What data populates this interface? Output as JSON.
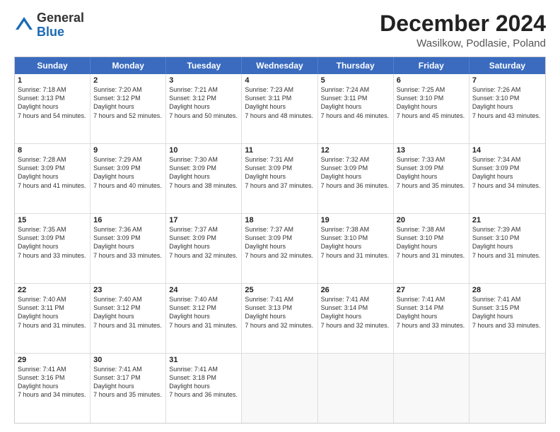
{
  "header": {
    "logo_general": "General",
    "logo_blue": "Blue",
    "main_title": "December 2024",
    "subtitle": "Wasilkow, Podlasie, Poland"
  },
  "days": [
    "Sunday",
    "Monday",
    "Tuesday",
    "Wednesday",
    "Thursday",
    "Friday",
    "Saturday"
  ],
  "weeks": [
    [
      {
        "day": "1",
        "sunrise": "7:18 AM",
        "sunset": "3:13 PM",
        "daylight": "7 hours and 54 minutes."
      },
      {
        "day": "2",
        "sunrise": "7:20 AM",
        "sunset": "3:12 PM",
        "daylight": "7 hours and 52 minutes."
      },
      {
        "day": "3",
        "sunrise": "7:21 AM",
        "sunset": "3:12 PM",
        "daylight": "7 hours and 50 minutes."
      },
      {
        "day": "4",
        "sunrise": "7:23 AM",
        "sunset": "3:11 PM",
        "daylight": "7 hours and 48 minutes."
      },
      {
        "day": "5",
        "sunrise": "7:24 AM",
        "sunset": "3:11 PM",
        "daylight": "7 hours and 46 minutes."
      },
      {
        "day": "6",
        "sunrise": "7:25 AM",
        "sunset": "3:10 PM",
        "daylight": "7 hours and 45 minutes."
      },
      {
        "day": "7",
        "sunrise": "7:26 AM",
        "sunset": "3:10 PM",
        "daylight": "7 hours and 43 minutes."
      }
    ],
    [
      {
        "day": "8",
        "sunrise": "7:28 AM",
        "sunset": "3:09 PM",
        "daylight": "7 hours and 41 minutes."
      },
      {
        "day": "9",
        "sunrise": "7:29 AM",
        "sunset": "3:09 PM",
        "daylight": "7 hours and 40 minutes."
      },
      {
        "day": "10",
        "sunrise": "7:30 AM",
        "sunset": "3:09 PM",
        "daylight": "7 hours and 38 minutes."
      },
      {
        "day": "11",
        "sunrise": "7:31 AM",
        "sunset": "3:09 PM",
        "daylight": "7 hours and 37 minutes."
      },
      {
        "day": "12",
        "sunrise": "7:32 AM",
        "sunset": "3:09 PM",
        "daylight": "7 hours and 36 minutes."
      },
      {
        "day": "13",
        "sunrise": "7:33 AM",
        "sunset": "3:09 PM",
        "daylight": "7 hours and 35 minutes."
      },
      {
        "day": "14",
        "sunrise": "7:34 AM",
        "sunset": "3:09 PM",
        "daylight": "7 hours and 34 minutes."
      }
    ],
    [
      {
        "day": "15",
        "sunrise": "7:35 AM",
        "sunset": "3:09 PM",
        "daylight": "7 hours and 33 minutes."
      },
      {
        "day": "16",
        "sunrise": "7:36 AM",
        "sunset": "3:09 PM",
        "daylight": "7 hours and 33 minutes."
      },
      {
        "day": "17",
        "sunrise": "7:37 AM",
        "sunset": "3:09 PM",
        "daylight": "7 hours and 32 minutes."
      },
      {
        "day": "18",
        "sunrise": "7:37 AM",
        "sunset": "3:09 PM",
        "daylight": "7 hours and 32 minutes."
      },
      {
        "day": "19",
        "sunrise": "7:38 AM",
        "sunset": "3:10 PM",
        "daylight": "7 hours and 31 minutes."
      },
      {
        "day": "20",
        "sunrise": "7:38 AM",
        "sunset": "3:10 PM",
        "daylight": "7 hours and 31 minutes."
      },
      {
        "day": "21",
        "sunrise": "7:39 AM",
        "sunset": "3:10 PM",
        "daylight": "7 hours and 31 minutes."
      }
    ],
    [
      {
        "day": "22",
        "sunrise": "7:40 AM",
        "sunset": "3:11 PM",
        "daylight": "7 hours and 31 minutes."
      },
      {
        "day": "23",
        "sunrise": "7:40 AM",
        "sunset": "3:12 PM",
        "daylight": "7 hours and 31 minutes."
      },
      {
        "day": "24",
        "sunrise": "7:40 AM",
        "sunset": "3:12 PM",
        "daylight": "7 hours and 31 minutes."
      },
      {
        "day": "25",
        "sunrise": "7:41 AM",
        "sunset": "3:13 PM",
        "daylight": "7 hours and 32 minutes."
      },
      {
        "day": "26",
        "sunrise": "7:41 AM",
        "sunset": "3:14 PM",
        "daylight": "7 hours and 32 minutes."
      },
      {
        "day": "27",
        "sunrise": "7:41 AM",
        "sunset": "3:14 PM",
        "daylight": "7 hours and 33 minutes."
      },
      {
        "day": "28",
        "sunrise": "7:41 AM",
        "sunset": "3:15 PM",
        "daylight": "7 hours and 33 minutes."
      }
    ],
    [
      {
        "day": "29",
        "sunrise": "7:41 AM",
        "sunset": "3:16 PM",
        "daylight": "7 hours and 34 minutes."
      },
      {
        "day": "30",
        "sunrise": "7:41 AM",
        "sunset": "3:17 PM",
        "daylight": "7 hours and 35 minutes."
      },
      {
        "day": "31",
        "sunrise": "7:41 AM",
        "sunset": "3:18 PM",
        "daylight": "7 hours and 36 minutes."
      },
      null,
      null,
      null,
      null
    ]
  ]
}
